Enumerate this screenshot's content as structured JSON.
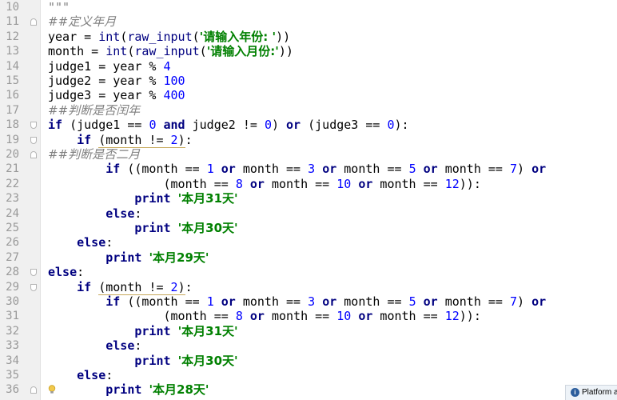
{
  "line_numbers": [
    "10",
    "11",
    "12",
    "13",
    "14",
    "15",
    "16",
    "17",
    "18",
    "19",
    "20",
    "21",
    "22",
    "23",
    "24",
    "25",
    "26",
    "27",
    "28",
    "29",
    "30",
    "31",
    "32",
    "33",
    "34",
    "35",
    "36"
  ],
  "code": [
    [
      {
        "t": "\"\"\"",
        "c": "cmt"
      }
    ],
    [
      {
        "t": "##定义年月",
        "c": "cmt"
      }
    ],
    [
      {
        "t": "year = "
      },
      {
        "t": "int",
        "c": "builtin"
      },
      {
        "t": "("
      },
      {
        "t": "raw_input",
        "c": "builtin"
      },
      {
        "t": "("
      },
      {
        "t": "'请输入年份: '",
        "c": "str"
      },
      {
        "t": "))"
      }
    ],
    [
      {
        "t": "month = "
      },
      {
        "t": "int",
        "c": "builtin"
      },
      {
        "t": "("
      },
      {
        "t": "raw_input",
        "c": "builtin"
      },
      {
        "t": "("
      },
      {
        "t": "'请输入月份:'",
        "c": "str"
      },
      {
        "t": "))"
      }
    ],
    [
      {
        "t": "judge1 = year % "
      },
      {
        "t": "4",
        "c": "num"
      }
    ],
    [
      {
        "t": "judge2 = year % "
      },
      {
        "t": "100",
        "c": "num"
      }
    ],
    [
      {
        "t": "judge3 = year % "
      },
      {
        "t": "400",
        "c": "num"
      }
    ],
    [
      {
        "t": "##判断是否闰年",
        "c": "cmt"
      }
    ],
    [
      {
        "t": "if",
        "c": "kw"
      },
      {
        "t": " (judge1 == "
      },
      {
        "t": "0",
        "c": "num"
      },
      {
        "t": " "
      },
      {
        "t": "and",
        "c": "kw"
      },
      {
        "t": " judge2 != "
      },
      {
        "t": "0",
        "c": "num"
      },
      {
        "t": ") "
      },
      {
        "t": "or",
        "c": "kw"
      },
      {
        "t": " (judge3 == "
      },
      {
        "t": "0",
        "c": "num"
      },
      {
        "t": "):"
      }
    ],
    [
      {
        "t": "    "
      },
      {
        "t": "if",
        "c": "kw"
      },
      {
        "t": " "
      },
      {
        "t": "(month != ",
        "c": "ul"
      },
      {
        "t": "2",
        "c": "num ul"
      },
      {
        "t": ")",
        "c": "ul"
      },
      {
        "t": ":"
      }
    ],
    [
      {
        "t": "##判断是否二月",
        "c": "cmt"
      }
    ],
    [
      {
        "t": "        "
      },
      {
        "t": "if",
        "c": "kw"
      },
      {
        "t": " ((month == "
      },
      {
        "t": "1",
        "c": "num"
      },
      {
        "t": " "
      },
      {
        "t": "or",
        "c": "kw"
      },
      {
        "t": " month == "
      },
      {
        "t": "3",
        "c": "num"
      },
      {
        "t": " "
      },
      {
        "t": "or",
        "c": "kw"
      },
      {
        "t": " month == "
      },
      {
        "t": "5",
        "c": "num"
      },
      {
        "t": " "
      },
      {
        "t": "or",
        "c": "kw"
      },
      {
        "t": " month == "
      },
      {
        "t": "7",
        "c": "num"
      },
      {
        "t": ") "
      },
      {
        "t": "or",
        "c": "kw"
      }
    ],
    [
      {
        "t": "                (month == "
      },
      {
        "t": "8",
        "c": "num"
      },
      {
        "t": " "
      },
      {
        "t": "or",
        "c": "kw"
      },
      {
        "t": " month == "
      },
      {
        "t": "10",
        "c": "num"
      },
      {
        "t": " "
      },
      {
        "t": "or",
        "c": "kw"
      },
      {
        "t": " month == "
      },
      {
        "t": "12",
        "c": "num"
      },
      {
        "t": ")):"
      }
    ],
    [
      {
        "t": "            "
      },
      {
        "t": "print",
        "c": "kw"
      },
      {
        "t": " "
      },
      {
        "t": "'本月31天'",
        "c": "str"
      }
    ],
    [
      {
        "t": "        "
      },
      {
        "t": "else",
        "c": "kw"
      },
      {
        "t": ":"
      }
    ],
    [
      {
        "t": "            "
      },
      {
        "t": "print",
        "c": "kw"
      },
      {
        "t": " "
      },
      {
        "t": "'本月30天'",
        "c": "str"
      }
    ],
    [
      {
        "t": "    "
      },
      {
        "t": "else",
        "c": "kw"
      },
      {
        "t": ":"
      }
    ],
    [
      {
        "t": "        "
      },
      {
        "t": "print",
        "c": "kw"
      },
      {
        "t": " "
      },
      {
        "t": "'本月29天'",
        "c": "str"
      }
    ],
    [
      {
        "t": "else",
        "c": "kw"
      },
      {
        "t": ":"
      }
    ],
    [
      {
        "t": "    "
      },
      {
        "t": "if",
        "c": "kw"
      },
      {
        "t": " "
      },
      {
        "t": "(month != ",
        "c": "ul"
      },
      {
        "t": "2",
        "c": "num ul"
      },
      {
        "t": ")",
        "c": "ul"
      },
      {
        "t": ":"
      }
    ],
    [
      {
        "t": "        "
      },
      {
        "t": "if",
        "c": "kw"
      },
      {
        "t": " ((month == "
      },
      {
        "t": "1",
        "c": "num"
      },
      {
        "t": " "
      },
      {
        "t": "or",
        "c": "kw"
      },
      {
        "t": " month == "
      },
      {
        "t": "3",
        "c": "num"
      },
      {
        "t": " "
      },
      {
        "t": "or",
        "c": "kw"
      },
      {
        "t": " month == "
      },
      {
        "t": "5",
        "c": "num"
      },
      {
        "t": " "
      },
      {
        "t": "or",
        "c": "kw"
      },
      {
        "t": " month == "
      },
      {
        "t": "7",
        "c": "num"
      },
      {
        "t": ") "
      },
      {
        "t": "or",
        "c": "kw"
      }
    ],
    [
      {
        "t": "                (month == "
      },
      {
        "t": "8",
        "c": "num"
      },
      {
        "t": " "
      },
      {
        "t": "or",
        "c": "kw"
      },
      {
        "t": " month == "
      },
      {
        "t": "10",
        "c": "num"
      },
      {
        "t": " "
      },
      {
        "t": "or",
        "c": "kw"
      },
      {
        "t": " month == "
      },
      {
        "t": "12",
        "c": "num"
      },
      {
        "t": ")):"
      }
    ],
    [
      {
        "t": "            "
      },
      {
        "t": "print",
        "c": "kw"
      },
      {
        "t": " "
      },
      {
        "t": "'本月31天'",
        "c": "str"
      }
    ],
    [
      {
        "t": "        "
      },
      {
        "t": "else",
        "c": "kw"
      },
      {
        "t": ":"
      }
    ],
    [
      {
        "t": "            "
      },
      {
        "t": "print",
        "c": "kw"
      },
      {
        "t": " "
      },
      {
        "t": "'本月30天'",
        "c": "str"
      }
    ],
    [
      {
        "t": "    "
      },
      {
        "t": "else",
        "c": "kw"
      },
      {
        "t": ":"
      }
    ],
    [
      {
        "t": "        "
      },
      {
        "t": "print",
        "c": "kw"
      },
      {
        "t": " "
      },
      {
        "t": "'本月28天'",
        "c": "str"
      }
    ]
  ],
  "colors": {
    "keyword": "#000080",
    "string": "#008000",
    "number": "#0000ff",
    "comment": "#808080",
    "gutter_bg": "#f0f0f0",
    "line_number": "#999999"
  },
  "icons": {
    "lightbulb": "lightbulb-icon",
    "info": "info-icon"
  },
  "status_badge": {
    "text": "Platform a"
  }
}
